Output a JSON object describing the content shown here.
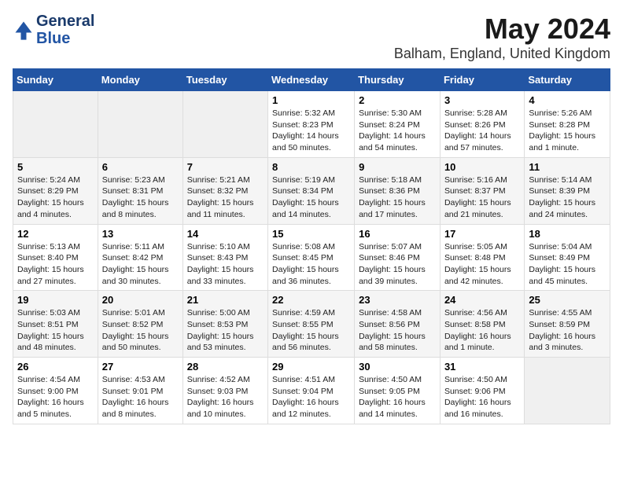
{
  "header": {
    "logo_line1": "General",
    "logo_line2": "Blue",
    "title": "May 2024",
    "subtitle": "Balham, England, United Kingdom"
  },
  "days_of_week": [
    "Sunday",
    "Monday",
    "Tuesday",
    "Wednesday",
    "Thursday",
    "Friday",
    "Saturday"
  ],
  "weeks": [
    [
      {
        "day": "",
        "empty": true
      },
      {
        "day": "",
        "empty": true
      },
      {
        "day": "",
        "empty": true
      },
      {
        "day": "1",
        "sunrise": "5:32 AM",
        "sunset": "8:23 PM",
        "daylight": "14 hours and 50 minutes."
      },
      {
        "day": "2",
        "sunrise": "5:30 AM",
        "sunset": "8:24 PM",
        "daylight": "14 hours and 54 minutes."
      },
      {
        "day": "3",
        "sunrise": "5:28 AM",
        "sunset": "8:26 PM",
        "daylight": "14 hours and 57 minutes."
      },
      {
        "day": "4",
        "sunrise": "5:26 AM",
        "sunset": "8:28 PM",
        "daylight": "15 hours and 1 minute."
      }
    ],
    [
      {
        "day": "5",
        "sunrise": "5:24 AM",
        "sunset": "8:29 PM",
        "daylight": "15 hours and 4 minutes."
      },
      {
        "day": "6",
        "sunrise": "5:23 AM",
        "sunset": "8:31 PM",
        "daylight": "15 hours and 8 minutes."
      },
      {
        "day": "7",
        "sunrise": "5:21 AM",
        "sunset": "8:32 PM",
        "daylight": "15 hours and 11 minutes."
      },
      {
        "day": "8",
        "sunrise": "5:19 AM",
        "sunset": "8:34 PM",
        "daylight": "15 hours and 14 minutes."
      },
      {
        "day": "9",
        "sunrise": "5:18 AM",
        "sunset": "8:36 PM",
        "daylight": "15 hours and 17 minutes."
      },
      {
        "day": "10",
        "sunrise": "5:16 AM",
        "sunset": "8:37 PM",
        "daylight": "15 hours and 21 minutes."
      },
      {
        "day": "11",
        "sunrise": "5:14 AM",
        "sunset": "8:39 PM",
        "daylight": "15 hours and 24 minutes."
      }
    ],
    [
      {
        "day": "12",
        "sunrise": "5:13 AM",
        "sunset": "8:40 PM",
        "daylight": "15 hours and 27 minutes."
      },
      {
        "day": "13",
        "sunrise": "5:11 AM",
        "sunset": "8:42 PM",
        "daylight": "15 hours and 30 minutes."
      },
      {
        "day": "14",
        "sunrise": "5:10 AM",
        "sunset": "8:43 PM",
        "daylight": "15 hours and 33 minutes."
      },
      {
        "day": "15",
        "sunrise": "5:08 AM",
        "sunset": "8:45 PM",
        "daylight": "15 hours and 36 minutes."
      },
      {
        "day": "16",
        "sunrise": "5:07 AM",
        "sunset": "8:46 PM",
        "daylight": "15 hours and 39 minutes."
      },
      {
        "day": "17",
        "sunrise": "5:05 AM",
        "sunset": "8:48 PM",
        "daylight": "15 hours and 42 minutes."
      },
      {
        "day": "18",
        "sunrise": "5:04 AM",
        "sunset": "8:49 PM",
        "daylight": "15 hours and 45 minutes."
      }
    ],
    [
      {
        "day": "19",
        "sunrise": "5:03 AM",
        "sunset": "8:51 PM",
        "daylight": "15 hours and 48 minutes."
      },
      {
        "day": "20",
        "sunrise": "5:01 AM",
        "sunset": "8:52 PM",
        "daylight": "15 hours and 50 minutes."
      },
      {
        "day": "21",
        "sunrise": "5:00 AM",
        "sunset": "8:53 PM",
        "daylight": "15 hours and 53 minutes."
      },
      {
        "day": "22",
        "sunrise": "4:59 AM",
        "sunset": "8:55 PM",
        "daylight": "15 hours and 56 minutes."
      },
      {
        "day": "23",
        "sunrise": "4:58 AM",
        "sunset": "8:56 PM",
        "daylight": "15 hours and 58 minutes."
      },
      {
        "day": "24",
        "sunrise": "4:56 AM",
        "sunset": "8:58 PM",
        "daylight": "16 hours and 1 minute."
      },
      {
        "day": "25",
        "sunrise": "4:55 AM",
        "sunset": "8:59 PM",
        "daylight": "16 hours and 3 minutes."
      }
    ],
    [
      {
        "day": "26",
        "sunrise": "4:54 AM",
        "sunset": "9:00 PM",
        "daylight": "16 hours and 5 minutes."
      },
      {
        "day": "27",
        "sunrise": "4:53 AM",
        "sunset": "9:01 PM",
        "daylight": "16 hours and 8 minutes."
      },
      {
        "day": "28",
        "sunrise": "4:52 AM",
        "sunset": "9:03 PM",
        "daylight": "16 hours and 10 minutes."
      },
      {
        "day": "29",
        "sunrise": "4:51 AM",
        "sunset": "9:04 PM",
        "daylight": "16 hours and 12 minutes."
      },
      {
        "day": "30",
        "sunrise": "4:50 AM",
        "sunset": "9:05 PM",
        "daylight": "16 hours and 14 minutes."
      },
      {
        "day": "31",
        "sunrise": "4:50 AM",
        "sunset": "9:06 PM",
        "daylight": "16 hours and 16 minutes."
      },
      {
        "day": "",
        "empty": true
      }
    ]
  ],
  "labels": {
    "sunrise": "Sunrise:",
    "sunset": "Sunset:",
    "daylight": "Daylight:"
  }
}
